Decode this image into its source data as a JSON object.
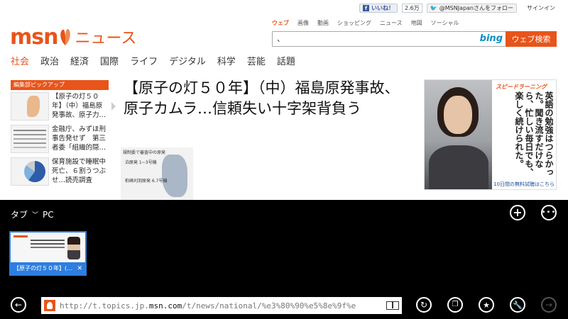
{
  "webpage": {
    "topbar": {
      "like_label": "いいね！",
      "like_count": "2.6万",
      "twitter_follow": "@MSNJapanさんをフォロー",
      "signin": "サインイン"
    },
    "logo": {
      "brand": "msn",
      "section": "ニュース"
    },
    "search": {
      "tabs": [
        "ウェブ",
        "画像",
        "動画",
        "ショッピング",
        "ニュース",
        "地図",
        "ソーシャル"
      ],
      "active_tab": "ウェブ",
      "query": "、",
      "engine": "bing",
      "button": "ウェブ検索"
    },
    "nav": {
      "items": [
        "社会",
        "政治",
        "経済",
        "国際",
        "ライフ",
        "デジタル",
        "科学",
        "芸能",
        "話題"
      ],
      "active": "社会"
    },
    "pickup": {
      "header": "編集部ピックアップ",
      "items": [
        {
          "text": "【原子の灯５０年】（中）福島原発事故、原子力…"
        },
        {
          "text": "金融庁、みずほ刑事告発せず　第三者委「組織的隠…"
        },
        {
          "text": "保育施設で睡眠中死亡、６割うつぶせ…読売調査"
        }
      ]
    },
    "headline": "【原子の灯５０年】（中）福島原発事故、原子カムラ…信頼失い十字架背負う",
    "figure": {
      "title": "規制委で審査中の原発",
      "label1": "泊原発 1~3号機",
      "label2": "柏崎刈羽原発 6.7号機"
    },
    "ad": {
      "brand": "スピードラーニング",
      "copy": "英語の勉強はつらかった。聞き流すだけなら、忙しい毎日でも、楽しく続けられた。",
      "footer": "10日間の無料試聴はこちら"
    }
  },
  "appbar": {
    "tabs_label": "タブ",
    "device": "PC",
    "new_tab_symbol": "+",
    "more_symbol": "•••",
    "tab": {
      "title": "【原子の灯５０年】(…",
      "close": "✕"
    },
    "url_prefix": "http://t.topics.jp.",
    "url_domain": "msn.com",
    "url_rest": "/t/news/national/%e3%80%90%e5%8e%9f%e",
    "icons": {
      "back": "←",
      "refresh": "↻",
      "pages": "❐",
      "favorite": "★",
      "tools": "🔧",
      "forward": "→"
    }
  }
}
